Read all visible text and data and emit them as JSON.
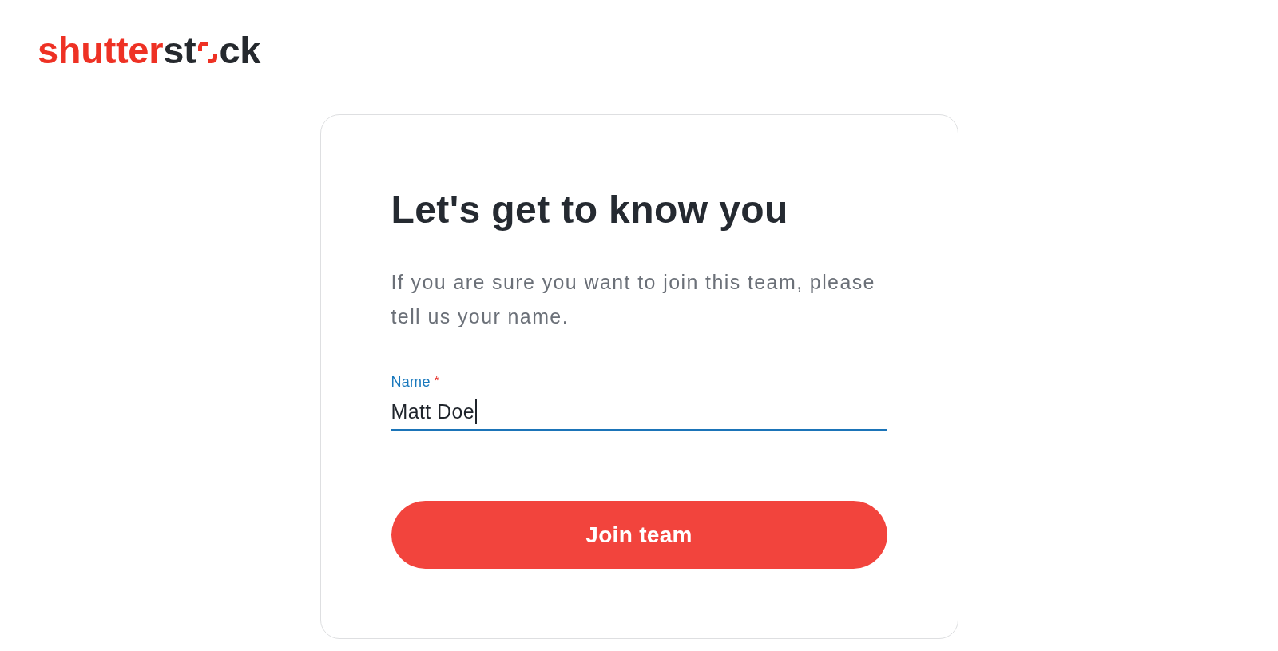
{
  "logo": {
    "parts": [
      {
        "kind": "text",
        "text": "shutter",
        "color": "#ee3124"
      },
      {
        "kind": "text",
        "text": "st",
        "color": "#25292e"
      },
      {
        "kind": "mark",
        "color": "#ee3124"
      },
      {
        "kind": "text",
        "text": "ck",
        "color": "#25292e"
      }
    ]
  },
  "card": {
    "title": "Let's get to know you",
    "intro": "If you are sure you want to join this team, please tell us your name.",
    "field": {
      "label": "Name",
      "required_mark": "*",
      "value": "Matt Doe",
      "focused": true
    },
    "submit": {
      "label": "Join team"
    }
  }
}
